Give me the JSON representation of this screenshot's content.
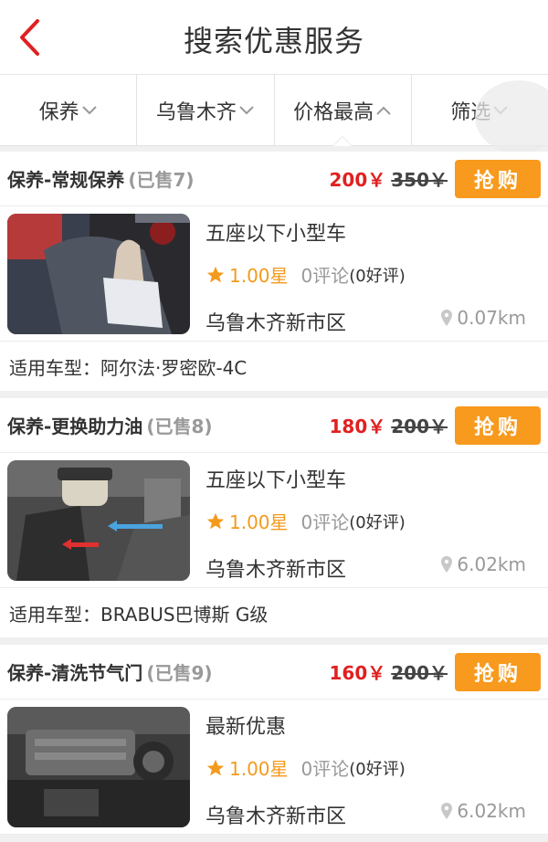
{
  "header": {
    "title": "搜索优惠服务",
    "back_icon": "chevron-left-icon",
    "back_color": "#e02020"
  },
  "filters": [
    {
      "label": "保养",
      "icon": "chevron-down-icon"
    },
    {
      "label": "乌鲁木齐",
      "icon": "chevron-down-icon"
    },
    {
      "label": "价格最高",
      "icon": "chevron-up-icon",
      "active": true
    },
    {
      "label": "筛选",
      "icon": "chevron-down-icon"
    }
  ],
  "items": [
    {
      "title": "保养-常规保养",
      "sold": "(已售7)",
      "price": "200￥",
      "old_price": "350￥",
      "buy_label": "抢购",
      "car_type": "五座以下小型车",
      "rating": "1.00星",
      "reviews": "0评论",
      "good_reviews": "(0好评)",
      "district": "乌鲁木齐新市区",
      "distance": "0.07km",
      "applicable": "适用车型：阿尔法·罗密欧-4C"
    },
    {
      "title": "保养-更换助力油",
      "sold": "(已售8)",
      "price": "180￥",
      "old_price": "200￥",
      "buy_label": "抢购",
      "car_type": "五座以下小型车",
      "rating": "1.00星",
      "reviews": "0评论",
      "good_reviews": "(0好评)",
      "district": "乌鲁木齐新市区",
      "distance": "6.02km",
      "applicable": "适用车型：BRABUS巴博斯 G级"
    },
    {
      "title": "保养-清洗节气门",
      "sold": "(已售9)",
      "price": "160￥",
      "old_price": "200￥",
      "buy_label": "抢购",
      "car_type": "最新优惠",
      "rating": "1.00星",
      "reviews": "0评论",
      "good_reviews": "(0好评)",
      "district": "乌鲁木齐新市区",
      "distance": "6.02km",
      "applicable": ""
    }
  ],
  "colors": {
    "accent": "#e02020",
    "buy": "#f79a1d",
    "star": "#f39a1d",
    "muted": "#999999"
  }
}
